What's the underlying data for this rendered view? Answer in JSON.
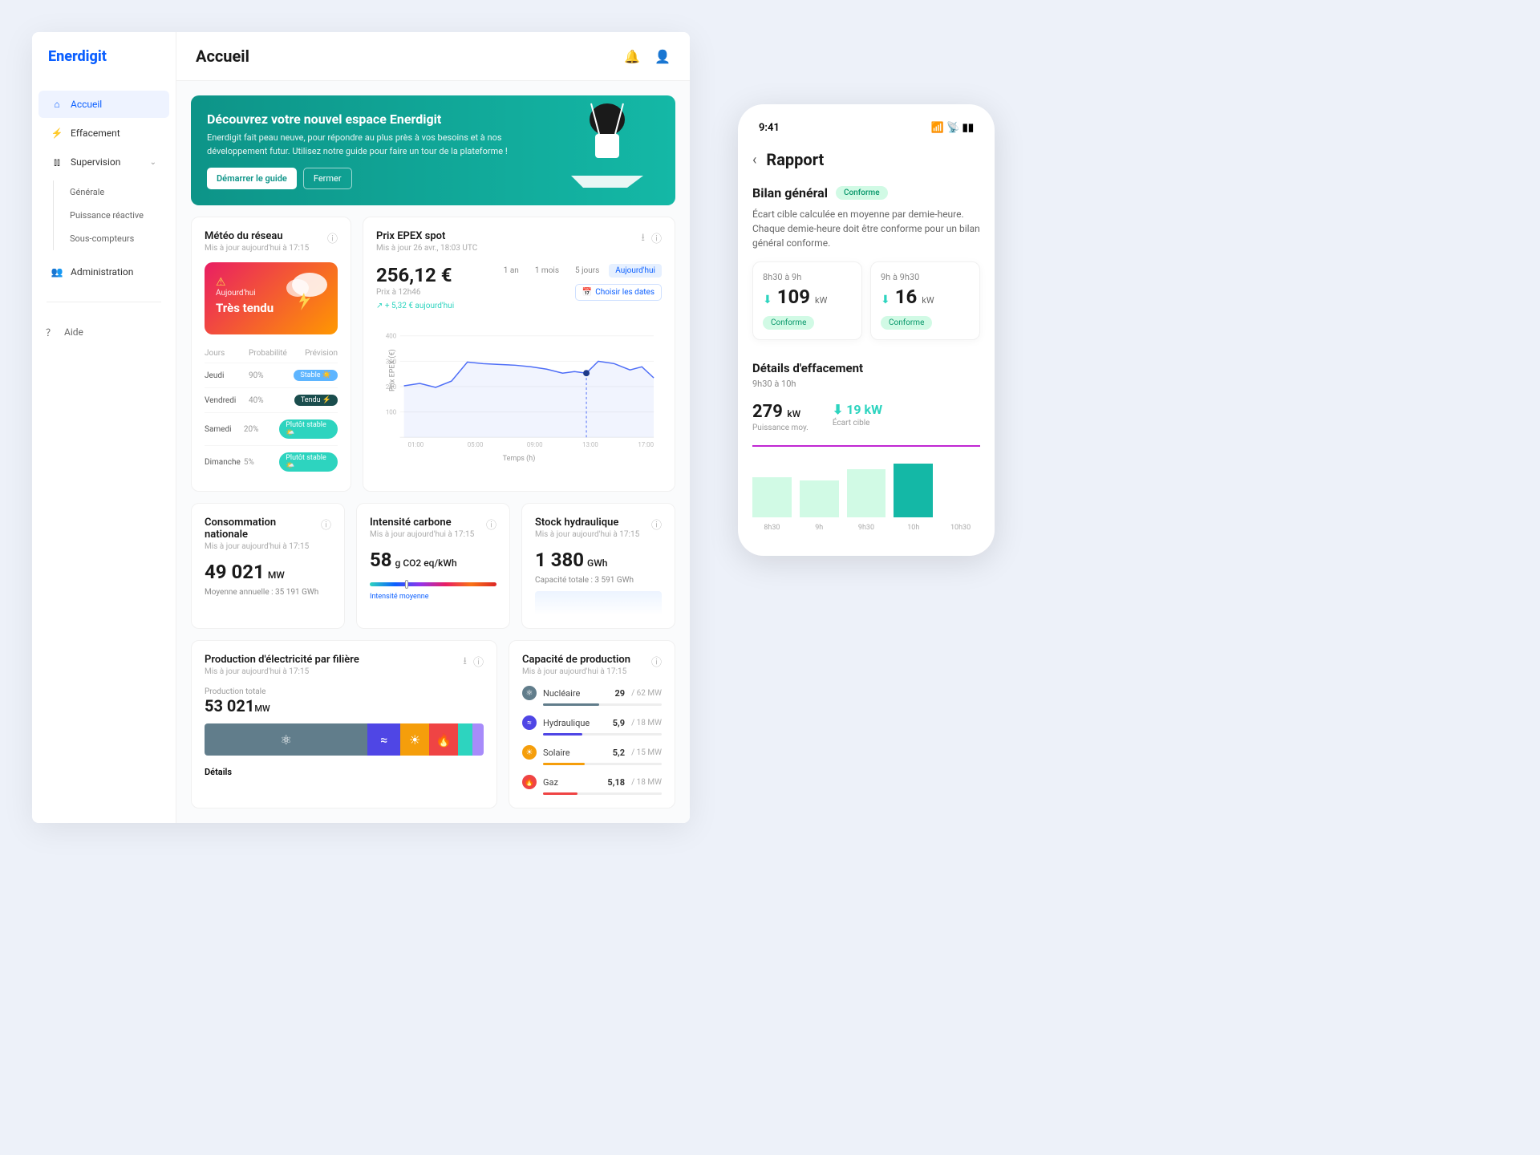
{
  "brand": "Enerdigit",
  "sidebar": {
    "items": [
      {
        "label": "Accueil",
        "active": true
      },
      {
        "label": "Effacement"
      },
      {
        "label": "Supervision",
        "expandable": true
      }
    ],
    "subitems": [
      "Générale",
      "Puissance réactive",
      "Sous-compteurs"
    ],
    "admin": "Administration",
    "help": "Aide"
  },
  "page_title": "Accueil",
  "banner": {
    "title": "Découvrez votre nouvel espace Enerdigit",
    "body": "Enerdigit fait peau neuve, pour répondre au plus près à vos besoins et à nos développement futur. Utilisez notre guide pour faire un tour de la plateforme !",
    "cta_primary": "Démarrer le guide",
    "cta_secondary": "Fermer"
  },
  "meteo": {
    "title": "Météo du réseau",
    "updated": "Mis à jour aujourd'hui à 17:15",
    "badge_small": "Aujourd'hui",
    "badge_big": "Très tendu",
    "cols": [
      "Jours",
      "Probabilité",
      "Prévision"
    ],
    "rows": [
      {
        "day": "Jeudi",
        "prob": "90%",
        "tag": "Stable",
        "cls": "pill-stable",
        "emo": "☀️"
      },
      {
        "day": "Vendredi",
        "prob": "40%",
        "tag": "Tendu",
        "cls": "pill-tendu",
        "emo": "⚡"
      },
      {
        "day": "Samedi",
        "prob": "20%",
        "tag": "Plutôt stable",
        "cls": "pill-plutot",
        "emo": "🌤️"
      },
      {
        "day": "Dimanche",
        "prob": "5%",
        "tag": "Plutôt stable",
        "cls": "pill-plutot",
        "emo": "🌤️"
      }
    ]
  },
  "epex": {
    "title": "Prix EPEX spot",
    "updated": "Mis à jour 26 avr., 18:03 UTC",
    "price": "256,12 €",
    "price_sub": "Prix à 12h46",
    "delta": "↗ + 5,32 € aujourd'hui",
    "tabs": [
      "1 an",
      "1 mois",
      "5 jours",
      "Aujourd'hui"
    ],
    "date_btn": "Choisir les dates",
    "ylabel": "Prix EPEX (€)",
    "xlabel": "Temps (h)"
  },
  "stats": {
    "conso": {
      "title": "Consommation nationale",
      "updated": "Mis à jour aujourd'hui à 17:15",
      "val": "49 021",
      "unit": "MW",
      "sub": "Moyenne annuelle : 35 191 GWh"
    },
    "carbon": {
      "title": "Intensité carbone",
      "updated": "Mis à jour aujourd'hui à 17:15",
      "val": "58",
      "unit": "g CO2 eq/kWh",
      "label": "Intensité moyenne"
    },
    "hydro": {
      "title": "Stock hydraulique",
      "updated": "Mis à jour aujourd'hui à 17:15",
      "val": "1 380",
      "unit": "GWh",
      "sub": "Capacité totale : 3 591 GWh"
    }
  },
  "production": {
    "title": "Production d'électricité par filière",
    "updated": "Mis à jour aujourd'hui à 17:15",
    "total_label": "Production totale",
    "total_val": "53 021",
    "total_unit": "MW",
    "details": "Détails"
  },
  "capacity": {
    "title": "Capacité de production",
    "updated": "Mis à jour aujourd'hui à 17:15",
    "rows": [
      {
        "name": "Nucléaire",
        "val": "29",
        "max": "/ 62 MW",
        "pct": 47,
        "color": "#617d8b"
      },
      {
        "name": "Hydraulique",
        "val": "5,9",
        "max": "/ 18 MW",
        "pct": 33,
        "color": "#4f46e5"
      },
      {
        "name": "Solaire",
        "val": "5,2",
        "max": "/ 15 MW",
        "pct": 35,
        "color": "#f59e0b"
      },
      {
        "name": "Gaz",
        "val": "5,18",
        "max": "/ 18 MW",
        "pct": 29,
        "color": "#ef4444"
      }
    ]
  },
  "chart_data": {
    "type": "line",
    "title": "Prix EPEX spot",
    "xlabel": "Temps (h)",
    "ylabel": "Prix EPEX (€)",
    "ylim": [
      0,
      400
    ],
    "x_ticks": [
      "01:00",
      "05:00",
      "09:00",
      "13:00",
      "17:00"
    ],
    "y_ticks": [
      100,
      200,
      300,
      400
    ],
    "series": [
      {
        "name": "Prix",
        "values": [
          220,
          230,
          210,
          240,
          310,
          305,
          300,
          295,
          290,
          280,
          260,
          265,
          260,
          310,
          300,
          270,
          290,
          250
        ]
      }
    ],
    "marker": {
      "x": "13:00",
      "y": 260
    }
  },
  "mobile": {
    "time": "9:41",
    "title": "Rapport",
    "bilan": {
      "title": "Bilan général",
      "badge": "Conforme",
      "desc": "Écart cible calculée en moyenne par demie-heure. Chaque demie-heure doit être conforme pour un bilan général conforme."
    },
    "cards": [
      {
        "time": "8h30 à 9h",
        "val": "109",
        "unit": "kW",
        "badge": "Conforme"
      },
      {
        "time": "9h à 9h30",
        "val": "16",
        "unit": "kW",
        "badge": "Conforme"
      }
    ],
    "details": {
      "title": "Détails d'effacement",
      "sub": "9h30 à 10h",
      "power": "279",
      "power_unit": "kW",
      "power_label": "Puissance moy.",
      "delta": "19",
      "delta_unit": "kW",
      "delta_label": "Écart cible"
    },
    "chart": {
      "labels": [
        "8h30",
        "9h",
        "9h30",
        "10h",
        "10h30"
      ],
      "values": [
        60,
        55,
        72,
        80,
        0
      ],
      "active_index": 3
    }
  }
}
